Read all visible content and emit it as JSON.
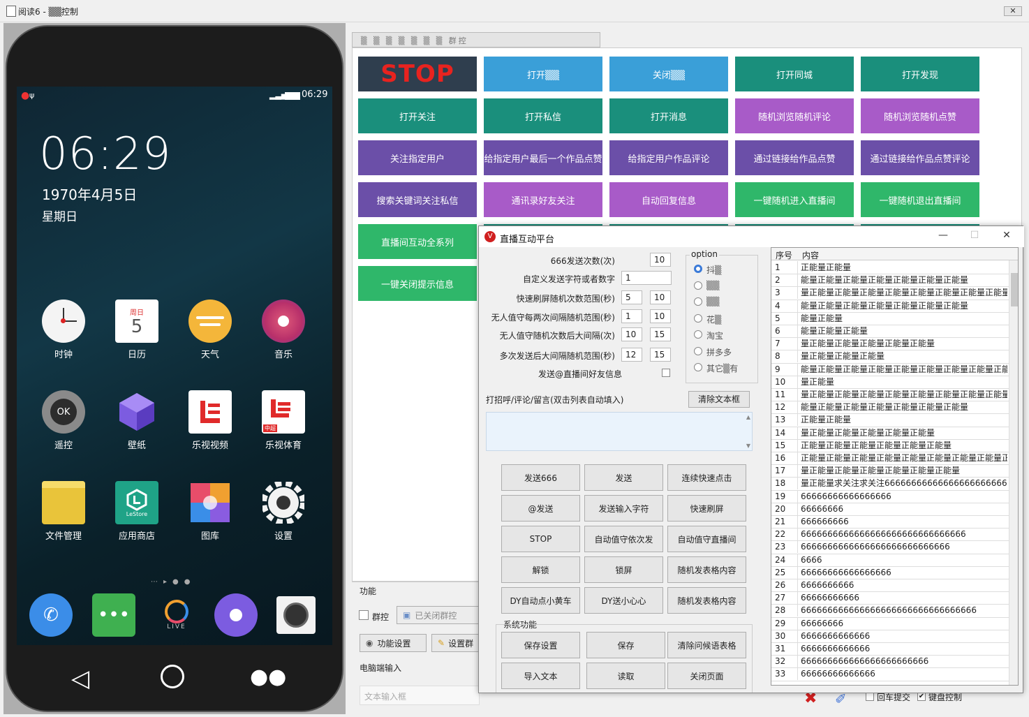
{
  "window": {
    "title": "阅读6 - ▒▒控制",
    "close_label": "✕"
  },
  "phone": {
    "status_time": "06:29",
    "clock": "06:29",
    "date": "1970年4月5日",
    "weekday": "星期日",
    "calendar_icon": {
      "day_label": "周日",
      "day_number": "5"
    },
    "apps": [
      {
        "label": "时钟",
        "icon": "clock-icon"
      },
      {
        "label": "日历",
        "icon": "calendar-icon"
      },
      {
        "label": "天气",
        "icon": "weather-icon"
      },
      {
        "label": "音乐",
        "icon": "music-icon"
      },
      {
        "label": "遥控",
        "icon": "remote-icon"
      },
      {
        "label": "壁纸",
        "icon": "wallpaper-icon"
      },
      {
        "label": "乐视视频",
        "icon": "letv-video-icon"
      },
      {
        "label": "乐视体育",
        "icon": "letv-sports-icon"
      },
      {
        "label": "文件管理",
        "icon": "folder-icon"
      },
      {
        "label": "应用商店",
        "icon": "lestore-icon"
      },
      {
        "label": "图库",
        "icon": "gallery-icon"
      },
      {
        "label": "设置",
        "icon": "settings-icon"
      }
    ],
    "remote_text": "OK",
    "lestore_text": "LeStore",
    "sports_badge": "中超",
    "dock_live_label": "LIVE"
  },
  "tabs": {
    "label": "▒ ▒ ▒ ▒ ▒ ▒ ▒ 群控"
  },
  "tiles": [
    {
      "label": "STOP",
      "style": "stoptile"
    },
    {
      "label": "打开▒▒",
      "style": "blue"
    },
    {
      "label": "关闭▒▒",
      "style": "blue"
    },
    {
      "label": "打开同城",
      "style": "teal"
    },
    {
      "label": "打开发现",
      "style": "teal"
    },
    {
      "label": "打开关注",
      "style": "teal"
    },
    {
      "label": "打开私信",
      "style": "teal"
    },
    {
      "label": "打开消息",
      "style": "teal"
    },
    {
      "label": "随机浏览随机评论",
      "style": "violet"
    },
    {
      "label": "随机浏览随机点赞",
      "style": "violet"
    },
    {
      "label": "关注指定用户",
      "style": "indigo"
    },
    {
      "label": "给指定用户最后一个作品点赞",
      "style": "indigo"
    },
    {
      "label": "给指定用户作品评论",
      "style": "indigo"
    },
    {
      "label": "通过链接给作品点赞",
      "style": "indigo"
    },
    {
      "label": "通过链接给作品点赞评论",
      "style": "indigo"
    },
    {
      "label": "搜索关键词关注私信",
      "style": "indigo"
    },
    {
      "label": "通讯录好友关注",
      "style": "violet"
    },
    {
      "label": "自动回复信息",
      "style": "violet"
    },
    {
      "label": "一键随机进入直播间",
      "style": "green"
    },
    {
      "label": "一键随机退出直播间",
      "style": "green"
    },
    {
      "label": "直播间互动全系列",
      "style": "green"
    },
    {
      "label": "一键关闭提示信息",
      "style": "green"
    }
  ],
  "lower": {
    "function_label": "功能",
    "group_control": "群控",
    "closed_group": "已关闭群控",
    "func_settings": "功能设置",
    "settings_group": "设置群",
    "pc_input": "电脑端输入",
    "text_input_placeholder": "文本输入框",
    "enter_submit": "回车提交",
    "keyboard_control": "键盘控制"
  },
  "dialog": {
    "title": "直播互动平台",
    "fields": [
      {
        "label": "666发送次数(次)",
        "value": "10"
      },
      {
        "label": "自定义发送字符或者数字",
        "value": "1"
      },
      {
        "label": "快速刷屏随机次数范围(秒)",
        "min": "5",
        "max": "10"
      },
      {
        "label": "无人值守每两次间隔随机范围(秒)",
        "min": "1",
        "max": "10"
      },
      {
        "label": "无人值守随机次数后大间隔(次)",
        "min": "10",
        "max": "15"
      },
      {
        "label": "多次发送后大间隔随机范围(秒)",
        "min": "12",
        "max": "15"
      }
    ],
    "send_at_label": "发送@直播间好友信息",
    "option_label": "option",
    "options": [
      "抖▒",
      "▒▒",
      "▒▒",
      "花▒",
      "淘宝",
      "拼多多",
      "其它▒有"
    ],
    "greeting_label": "打招呼/评论/留言(双击列表自动填入)",
    "clear_button": "清除文本框",
    "buttons": [
      "发送666",
      "发送",
      "连续快速点击",
      "@发送",
      "发送输入字符",
      "快速刷屏",
      "STOP",
      "自动值守依次发",
      "自动值守直播间",
      "解锁",
      "锁屏",
      "随机发表格内容",
      "DY自动点小黄车",
      "DY送小心心",
      "随机发表格内容"
    ],
    "system_label": "系统功能",
    "system_buttons": [
      "保存设置",
      "保存",
      "清除问候语表格",
      "导入文本",
      "读取",
      "关闭页面"
    ],
    "grid_headers": {
      "no": "序号",
      "content": "内容"
    },
    "grid_rows": [
      "正能量正能量",
      "能量正能量正能量正能量正能量正能量正能量",
      "量正能量正能量正能量正能量正能量正能量正能量正能量正能",
      "能量正能量正能量正能量正能量正能量正能量",
      "能量正能量",
      "能量正能量正能量",
      "量正能量正能量正能量正能量正能量",
      "量正能量正能量正能量",
      "能量正能量正能量正能量正能量正能量正能量正能量正能",
      "量正能量",
      "量正能量正能量正能量正能量正能量正能量正能量正能量正能",
      "能量正能量正能量正能量正能量正能量正能量",
      "正能量正能量",
      "量正能量正能量正能量正能量正能量",
      "正能量正能量正能量正能量正能量正能量",
      "正能量正能量正能量正能量正能量正能量正能量正能量正能量",
      "量正能量正能量正能量正能量正能量正能量",
      "量正能量求关注求关注66666666666666666666666",
      "66666666666666666",
      "66666666",
      "666666666",
      "6666666666666666666666666666666",
      "6666666666666666666666666666",
      "6666",
      "66666666666666666",
      "6666666666",
      "66666666666",
      "666666666666666666666666666666666",
      "66666666",
      "6666666666666",
      "6666666666666",
      "666666666666666666666666",
      "66666666666666"
    ]
  }
}
